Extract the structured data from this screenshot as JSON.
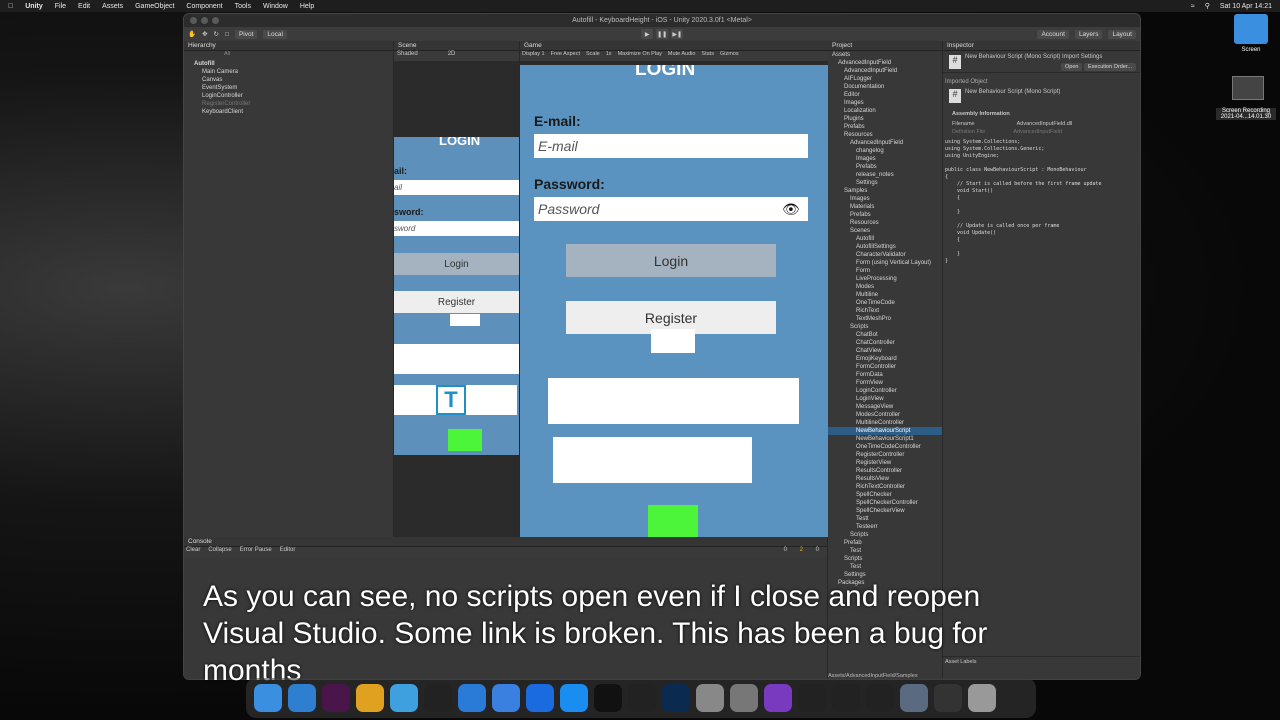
{
  "menubar": {
    "app": "Unity",
    "items": [
      "File",
      "Edit",
      "Assets",
      "GameObject",
      "Component",
      "Tools",
      "Window",
      "Help"
    ],
    "datetime": "Sat 10 Apr  14:21"
  },
  "window": {
    "title": "Autofill - KeyboardHeight - iOS - Unity 2020.3.0f1 <Metal>"
  },
  "toolbar": {
    "pivot": "Pivot",
    "local": "Local",
    "account": "Account",
    "layers": "Layers",
    "layout": "Layout"
  },
  "hierarchy": {
    "tab": "Hierarchy",
    "search_placeholder": "All",
    "root": "Autofill",
    "items": [
      "Main Camera",
      "Canvas",
      "EventSystem",
      "LoginController",
      "RegisterController",
      "KeyboardClient"
    ]
  },
  "scene": {
    "tab": "Scene",
    "shading": "Shaded",
    "mode": "2D",
    "login_title": "LOGIN",
    "email_label": "ail:",
    "email_value": "ail",
    "password_label": "sword:",
    "password_value": "sword",
    "login_button": "Login",
    "register_button": "Register",
    "text_icon": "T"
  },
  "game": {
    "tab": "Game",
    "display": "Display 1",
    "aspect": "Free Aspect",
    "scale": "Scale",
    "scale_value": "1x",
    "maximize": "Maximize On Play",
    "mute": "Mute Audio",
    "stats": "Stats",
    "gizmos": "Gizmos",
    "login_title": "LOGIN",
    "email_label": "E-mail:",
    "email_placeholder": "E-mail",
    "password_label": "Password:",
    "password_placeholder": "Password",
    "login_button": "Login",
    "register_button": "Register"
  },
  "project": {
    "tab": "Project",
    "items": [
      "Assets",
      "AdvancedInputField",
      "AdvancedInputField",
      "AIFLogger",
      "Documentation",
      "Editor",
      "Images",
      "Localization",
      "Plugins",
      "Prefabs",
      "Resources",
      "AdvancedInputField",
      "changelog",
      "Images",
      "Prefabs",
      "release_notes",
      "Settings",
      "Samples",
      "Images",
      "Materials",
      "Prefabs",
      "Resources",
      "Scenes",
      "Autofill",
      "AutofillSettings",
      "CharacterValidator",
      "Form (using Vertical Layout)",
      "Form",
      "LiveProcessing",
      "Modes",
      "Multiline",
      "OneTimeCode",
      "RichText",
      "TextMeshPro",
      "Scripts",
      "ChatBot",
      "ChatController",
      "ChatView",
      "EmojiKeyboard",
      "FormController",
      "FormData",
      "FormView",
      "LoginController",
      "LoginView",
      "MessageView",
      "ModesController",
      "MultilineController",
      "NewBehaviourScript",
      "NewBehaviourScript1",
      "OneTimeCodeController",
      "RegisterController",
      "RegisterView",
      "ResultsController",
      "ResultsView",
      "RichTextController",
      "SpellChecker",
      "SpellCheckerController",
      "SpellCheckerView",
      "Testt",
      "Testeerr",
      "Scripts",
      "Prefab",
      "Test",
      "Scripts",
      "Test",
      "Settings",
      "Packages"
    ],
    "path": "Assets/AdvancedInputField/Samples"
  },
  "inspector": {
    "tab": "Inspector",
    "title": "New Behaviour Script (Mono Script) Import Settings",
    "open": "Open",
    "exec_order": "Execution Order...",
    "imported": "Imported Object",
    "obj_title": "New Behaviour Script (Mono Script)",
    "assembly": "Assembly Information",
    "filename_label": "Filename",
    "filename_value": "AdvancedInputField.dll",
    "def_label": "Definition File",
    "def_value": "AdvancedInputField",
    "code": [
      "using System.Collections;",
      "using System.Collections.Generic;",
      "using UnityEngine;",
      "",
      "public class NewBehaviourScript : MonoBehaviour",
      "{",
      "    // Start is called before the first frame update",
      "    void Start()",
      "    {",
      "",
      "    }",
      "",
      "    // Update is called once per frame",
      "    void Update()",
      "    {",
      "",
      "    }",
      "}"
    ],
    "asset_labels": "Asset Labels"
  },
  "console": {
    "tab": "Console",
    "clear": "Clear",
    "collapse": "Collapse",
    "error_pause": "Error Pause",
    "editor": "Editor",
    "count_info": "0",
    "count_warn": "2",
    "count_err": "0"
  },
  "subtitle": "As you can see, no scripts open even if I close and reopen Visual Studio. Some link is broken. This has been a bug for months",
  "desktop": {
    "folder_label": "Screen",
    "recording_label": "Screen Recording 2021-04...14.01.30"
  },
  "dock": {
    "icons": [
      "finder-icon",
      "vscode-icon",
      "slack-icon",
      "chrome-icon",
      "maps-icon",
      "unity-icon",
      "xcode-icon",
      "mail-icon",
      "c-icon",
      "appstore-icon",
      "terminal-icon",
      "unity-icon",
      "photoshop-icon",
      "launchpad-icon",
      "settings-icon",
      "visualstudio-icon",
      "unity-icon",
      "unity-icon",
      "unity-icon",
      "docs-icon",
      "screens-icon",
      "trash-icon"
    ]
  }
}
